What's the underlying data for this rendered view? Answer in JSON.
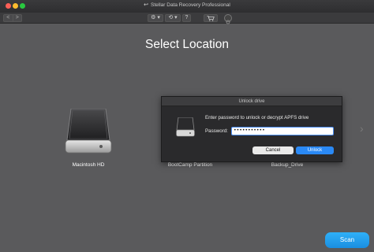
{
  "window": {
    "title": "Stellar Data Recovery Professional"
  },
  "toolbar": {
    "back": "<",
    "forward": ">",
    "settings": "⚙ ▾",
    "history": "⟲ ▾",
    "help": "?"
  },
  "main": {
    "heading": "Select Location",
    "drives": [
      {
        "label": "Macintosh HD"
      },
      {
        "label": "BootCamp Partition"
      },
      {
        "label": "Backup_Drive"
      }
    ],
    "next_arrow": "›"
  },
  "dialog": {
    "title": "Unlock drive",
    "message": "Enter password to unlock or decrypt APFS drive",
    "password_label": "Password:",
    "password_value": "•••••••••••",
    "cancel_label": "Cancel",
    "unlock_label": "Unlock"
  },
  "scan_label": "Scan",
  "colors": {
    "accent": "#2a89f5",
    "scan": "#1a9ef0",
    "background": "#5a5a5c"
  }
}
